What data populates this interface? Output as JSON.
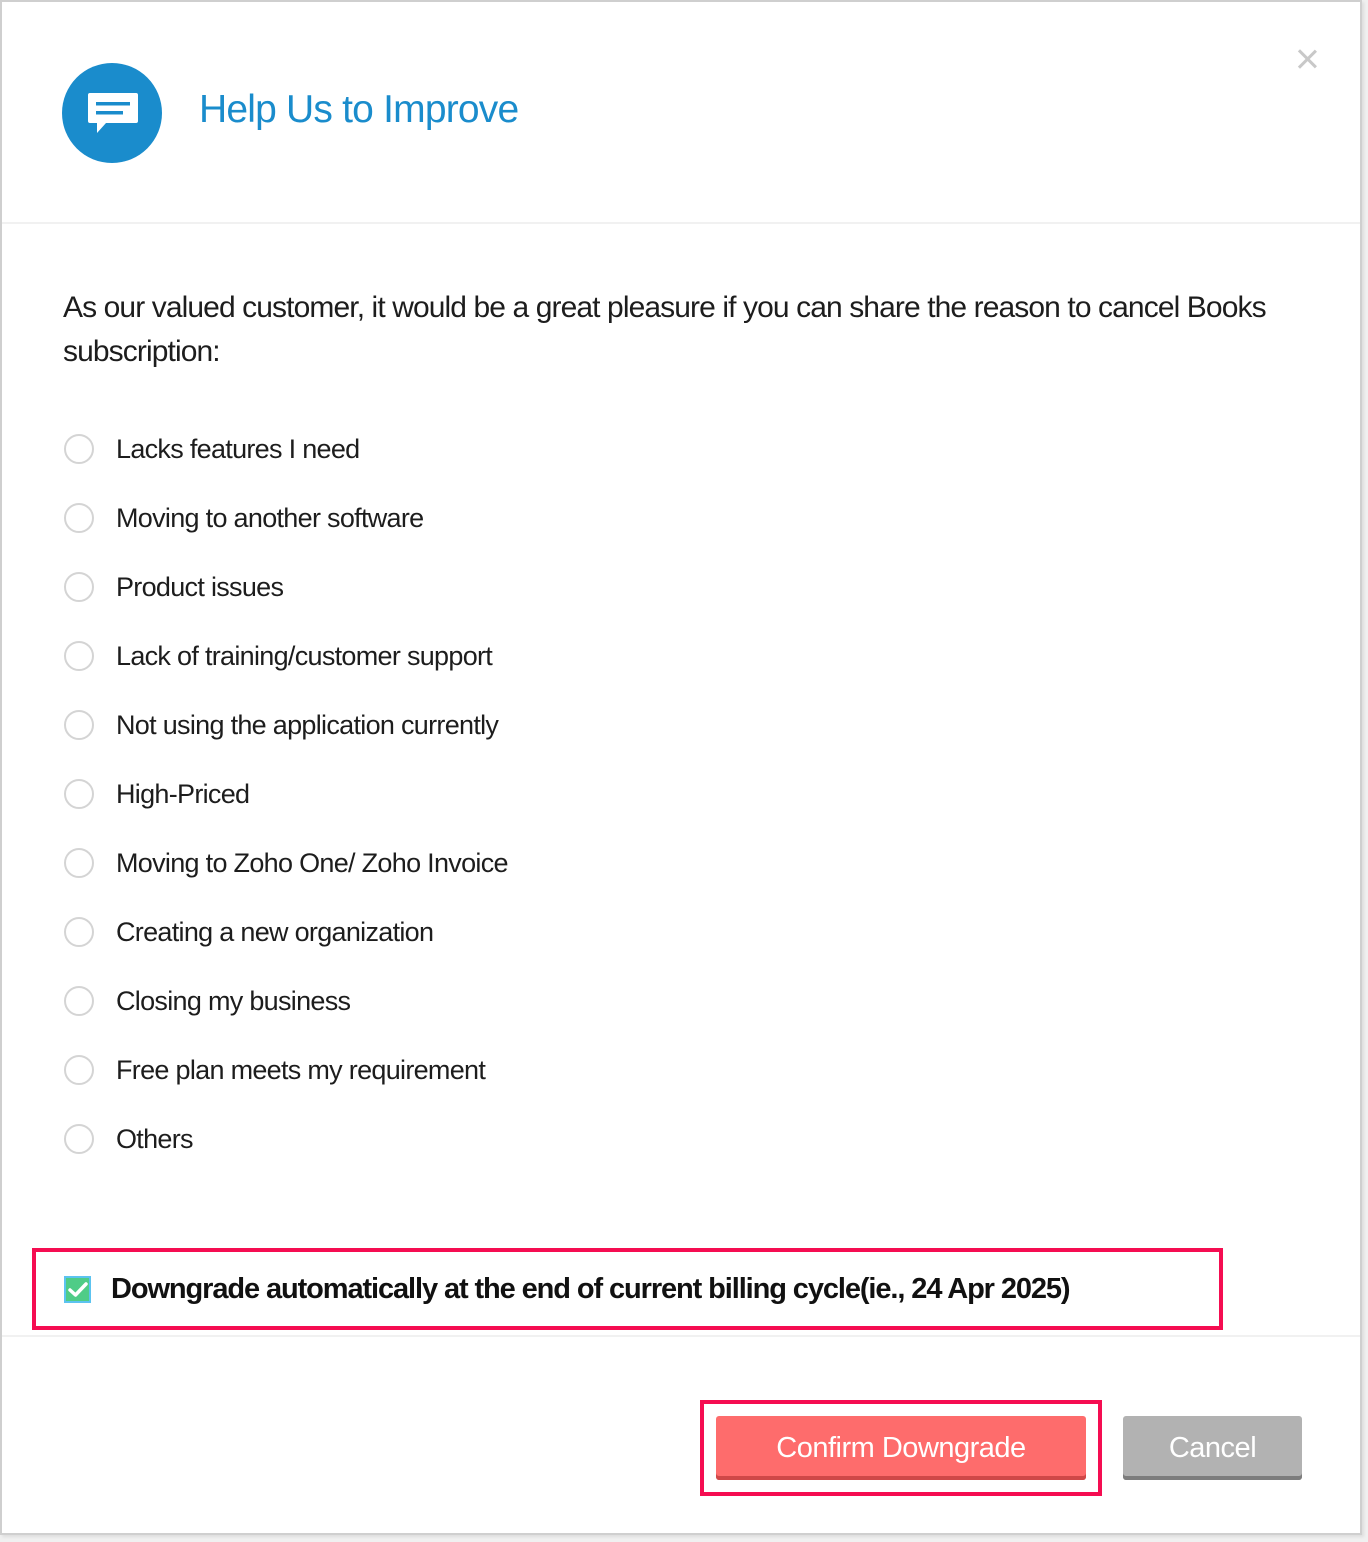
{
  "dialog": {
    "title": "Help Us to Improve",
    "header_icon": "chat-bubble-icon",
    "close_icon": "close-icon",
    "intro_text": "As our valued customer, it would be a great pleasure if you can share the reason to cancel Books subscription:",
    "reasons": [
      {
        "label": "Lacks features I need",
        "selected": false
      },
      {
        "label": "Moving to another software",
        "selected": false
      },
      {
        "label": "Product issues",
        "selected": false
      },
      {
        "label": "Lack of training/customer support",
        "selected": false
      },
      {
        "label": "Not using the application currently",
        "selected": false
      },
      {
        "label": "High-Priced",
        "selected": false
      },
      {
        "label": "Moving to Zoho One/ Zoho Invoice",
        "selected": false
      },
      {
        "label": "Creating a new organization",
        "selected": false
      },
      {
        "label": "Closing my business",
        "selected": false
      },
      {
        "label": "Free plan meets my requirement",
        "selected": false
      },
      {
        "label": "Others",
        "selected": false
      }
    ],
    "auto_downgrade": {
      "label": "Downgrade automatically at the end of current billing cycle(ie., 24 Apr 2025)",
      "checked": true
    },
    "buttons": {
      "confirm": "Confirm Downgrade",
      "cancel": "Cancel"
    }
  },
  "colors": {
    "accent": "#1a8ccc",
    "highlight": "#f50d51",
    "confirm": "#fe6c6c",
    "cancel": "#b2b2b2",
    "checkbox": "#4fcc87"
  }
}
